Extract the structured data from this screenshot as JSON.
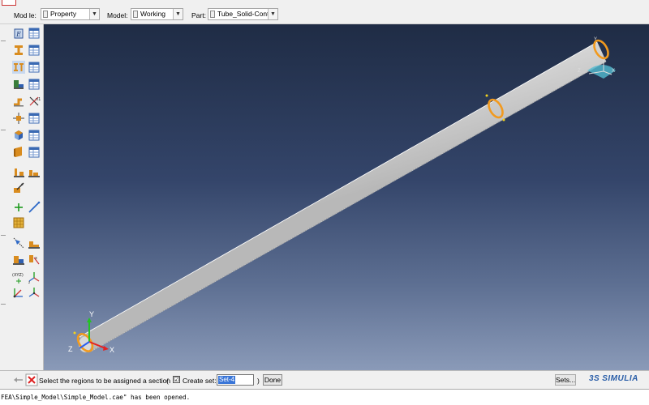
{
  "toolbar": {
    "module_label": "Mod   le:",
    "module_value": "Property",
    "model_label": "Model:",
    "model_value": "Working",
    "part_label": "Part:",
    "part_value": "Tube_Solid-Cont"
  },
  "toolbox": {
    "icons": [
      "create-material-icon",
      "material-manager-icon",
      "create-section-icon",
      "section-manager-icon",
      "create-profile-icon",
      "profile-manager-icon",
      "assign-section-icon",
      "assignment-manager-icon",
      "assign-beam-orientation-icon",
      "rebar-reference-icon",
      "special-inertia-icon",
      "inertia-manager-icon",
      "skin-icon",
      "skin-manager-icon",
      "stringer-icon",
      "stringer-manager-icon",
      "composite-layup-icon",
      "layup-manager-icon",
      "assign-material-orientation-icon",
      "datum-point-icon",
      "datum-axis-icon",
      "datum-plane-icon",
      "query-icon",
      "partition-icon",
      "partition-cell-icon",
      "partition-face-icon",
      "datum-csys-icon",
      "datum-csys-manager-icon",
      "transform-icon",
      "csys-tools-icon"
    ]
  },
  "viewport": {
    "triad_labels": {
      "y": "Y",
      "z": "Z",
      "x": "X"
    },
    "view_triad": {
      "y": "Y",
      "z": "Z",
      "x": "X"
    }
  },
  "prompt": {
    "message": "Select the regions to be assigned a section",
    "open_paren": "(",
    "create_set_label": "Create set:",
    "create_set_checked": "☑",
    "set_name": "Set-4",
    "close_paren": ")",
    "done_label": "Done",
    "sets_label": "Sets..."
  },
  "brand": {
    "name": "SIMULIA",
    "mark": "3S"
  },
  "messages": {
    "line": "FEA\\Simple_Model\\Simple_Model.cae\" has been opened."
  },
  "colors": {
    "viewport_top": "#1f2c45",
    "viewport_bottom": "#8a9ab8",
    "highlight": "#f29a1e",
    "set_selection": "#3a76d8"
  }
}
